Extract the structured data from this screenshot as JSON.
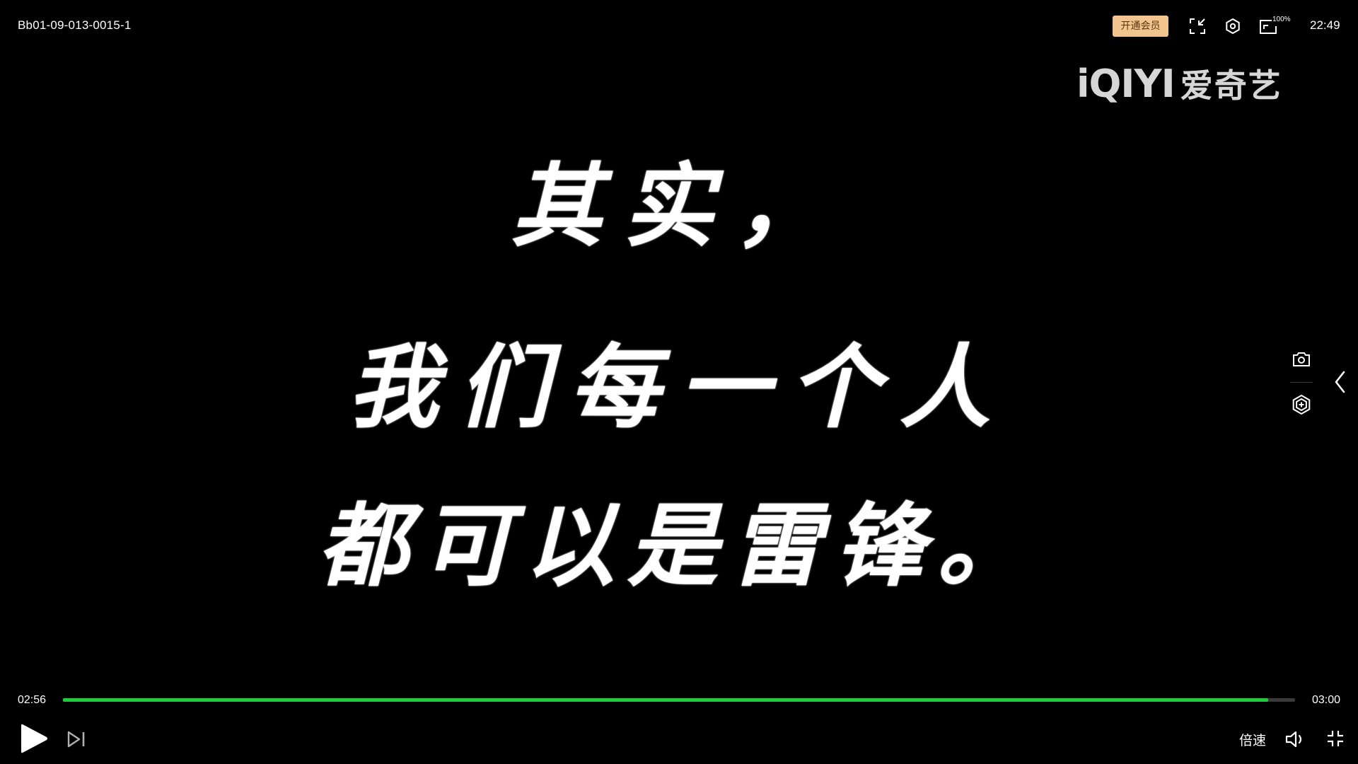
{
  "player": {
    "title": "Bb01-09-013-0015-1",
    "vip_label": "开通会员",
    "zoom_label": "100%",
    "clock": "22:49",
    "logo": {
      "en": "iQIYI",
      "cn": "爱奇艺"
    }
  },
  "subtitles": {
    "line1": "其实，",
    "line2": "我们每一个人",
    "line3": "都可以是雷锋。"
  },
  "progress": {
    "current_time": "02:56",
    "total_time": "03:00",
    "fraction": 0.978
  },
  "controls": {
    "speed_label": "倍速"
  },
  "icons": {
    "top": [
      "exit-mini-icon",
      "settings-icon",
      "zoom-icon"
    ],
    "side": [
      "screenshot-icon",
      "clip-icon",
      "chevron-left-icon"
    ],
    "bottom": [
      "play-icon",
      "next-icon",
      "volume-icon",
      "exit-fullscreen-icon"
    ]
  },
  "colors": {
    "background": "#000000",
    "progress_fill": "#1ccd3c",
    "progress_track": "#3a3a3a",
    "vip_background": "#f2c58f",
    "vip_text": "#5a3510",
    "logo": "#d6d6d6"
  }
}
